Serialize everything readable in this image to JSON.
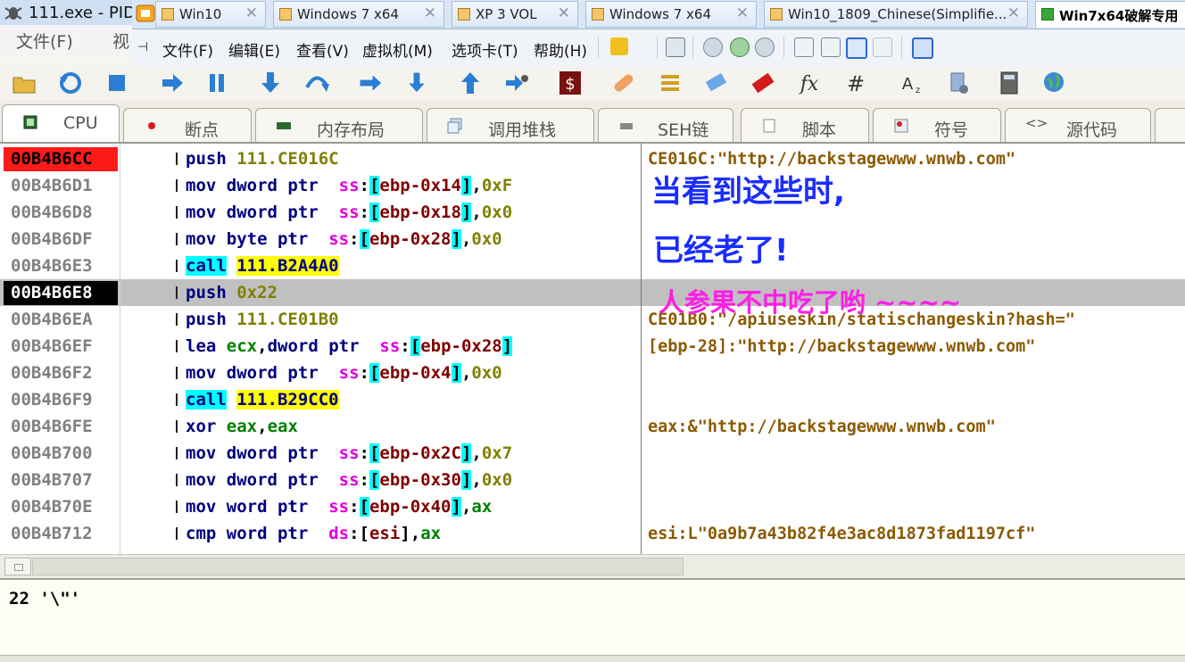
{
  "outer_window": {
    "title": "111.exe - PID",
    "menu": {
      "file": "文件(F)",
      "view": "视"
    }
  },
  "vmware": {
    "tabs": [
      {
        "label": "Win10"
      },
      {
        "label": "Windows 7 x64"
      },
      {
        "label": "XP 3 VOL"
      },
      {
        "label": "Windows 7 x64"
      },
      {
        "label": "Win10_1809_Chinese(Simplifie..."
      },
      {
        "label": "Win7x64破解专用"
      }
    ],
    "menu": [
      {
        "label": "文件(F)"
      },
      {
        "label": "编辑(E)"
      },
      {
        "label": "查看(V)"
      },
      {
        "label": "虚拟机(M)"
      },
      {
        "label": "选项卡(T)"
      },
      {
        "label": "帮助(H)"
      }
    ]
  },
  "debugger_tabs": [
    {
      "label": "CPU"
    },
    {
      "label": "断点"
    },
    {
      "label": "内存布局"
    },
    {
      "label": "调用堆栈"
    },
    {
      "label": "SEH链"
    },
    {
      "label": "脚本"
    },
    {
      "label": "符号"
    },
    {
      "label": "源代码"
    }
  ],
  "disassembly": {
    "rows": [
      {
        "address": "00B4B6CC",
        "m": "push",
        "o1": "111.CE016C",
        "comment": "CE016C:\"http://backstagewww.wnwb.com\""
      },
      {
        "address": "00B4B6D1",
        "m": "mov",
        "o1": "dword ptr",
        "o2": "ss",
        "o3": "ebp-0x14",
        "o4": "0xF"
      },
      {
        "address": "00B4B6D8",
        "m": "mov",
        "o1": "dword ptr",
        "o2": "ss",
        "o3": "ebp-0x18",
        "o4": "0x0"
      },
      {
        "address": "00B4B6DF",
        "m": "mov",
        "o1": "byte ptr",
        "o2": "ss",
        "o3": "ebp-0x28",
        "o4": "0x0"
      },
      {
        "address": "00B4B6E3",
        "m": "call",
        "o1": "111.B2A4A0"
      },
      {
        "address": "00B4B6E8",
        "m": "push",
        "o1": "0x22"
      },
      {
        "address": "00B4B6EA",
        "m": "push",
        "o1": "111.CE01B0",
        "comment": "CE01B0:\"/apiuseskin/statischangeskin?hash=\""
      },
      {
        "address": "00B4B6EF",
        "m": "lea",
        "o1": "ecx",
        "o2": "dword ptr",
        "o3": "ss",
        "o4": "ebp-0x28",
        "comment": "[ebp-28]:\"http://backstagewww.wnwb.com\""
      },
      {
        "address": "00B4B6F2",
        "m": "mov",
        "o1": "dword ptr",
        "o2": "ss",
        "o3": "ebp-0x4",
        "o4": "0x0"
      },
      {
        "address": "00B4B6F9",
        "m": "call",
        "o1": "111.B29CC0"
      },
      {
        "address": "00B4B6FE",
        "m": "xor",
        "o1": "eax",
        "o2": "eax",
        "comment": "eax:&\"http://backstagewww.wnwb.com\""
      },
      {
        "address": "00B4B700",
        "m": "mov",
        "o1": "dword ptr",
        "o2": "ss",
        "o3": "ebp-0x2C",
        "o4": "0x7"
      },
      {
        "address": "00B4B707",
        "m": "mov",
        "o1": "dword ptr",
        "o2": "ss",
        "o3": "ebp-0x30",
        "o4": "0x0"
      },
      {
        "address": "00B4B70E",
        "m": "mov",
        "o1": "word ptr",
        "o2": "ss",
        "o3": "ebp-0x40",
        "o4": "ax"
      },
      {
        "address": "00B4B712",
        "m": "cmp",
        "o1": "word ptr",
        "o2": "ds",
        "o3": "esi",
        "o4": "ax",
        "comment": "esi:L\"0a9b7a43b82f4e3ac8d1873fad1197cf\""
      }
    ]
  },
  "overlay": {
    "line1": "当看到这些时,",
    "line2": "已经老了!",
    "line3": "人参果不中吃了哟 ~~~~"
  },
  "info_pane": {
    "text": "22 '\\\"'"
  },
  "colors": {
    "eip_highlight": "#ff1a1a",
    "selected_row": "#c0c0c0",
    "bracket_bg": "#00ffff",
    "call_target_bg": "#ffff00",
    "overlay_blue": "#1a2cff",
    "overlay_magenta": "#ff1ee8"
  }
}
